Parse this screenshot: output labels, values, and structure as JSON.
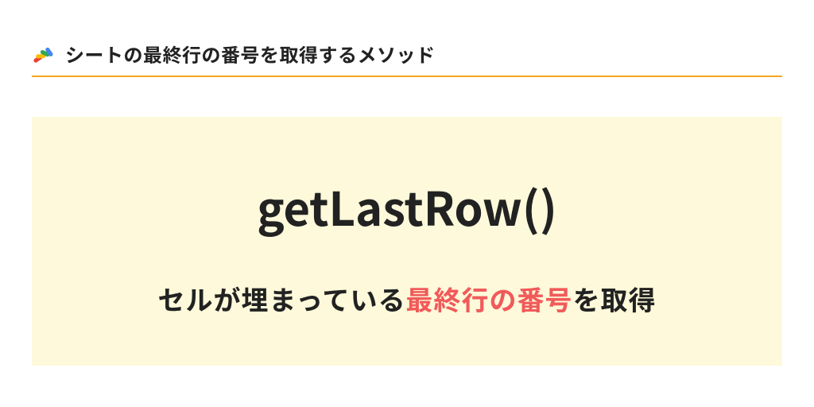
{
  "header": {
    "title": "シートの最終行の番号を取得するメソッド"
  },
  "content": {
    "method_name": "getLastRow()",
    "desc_prefix": "セルが埋まっている",
    "desc_highlight": "最終行の番号",
    "desc_suffix": "を取得"
  }
}
